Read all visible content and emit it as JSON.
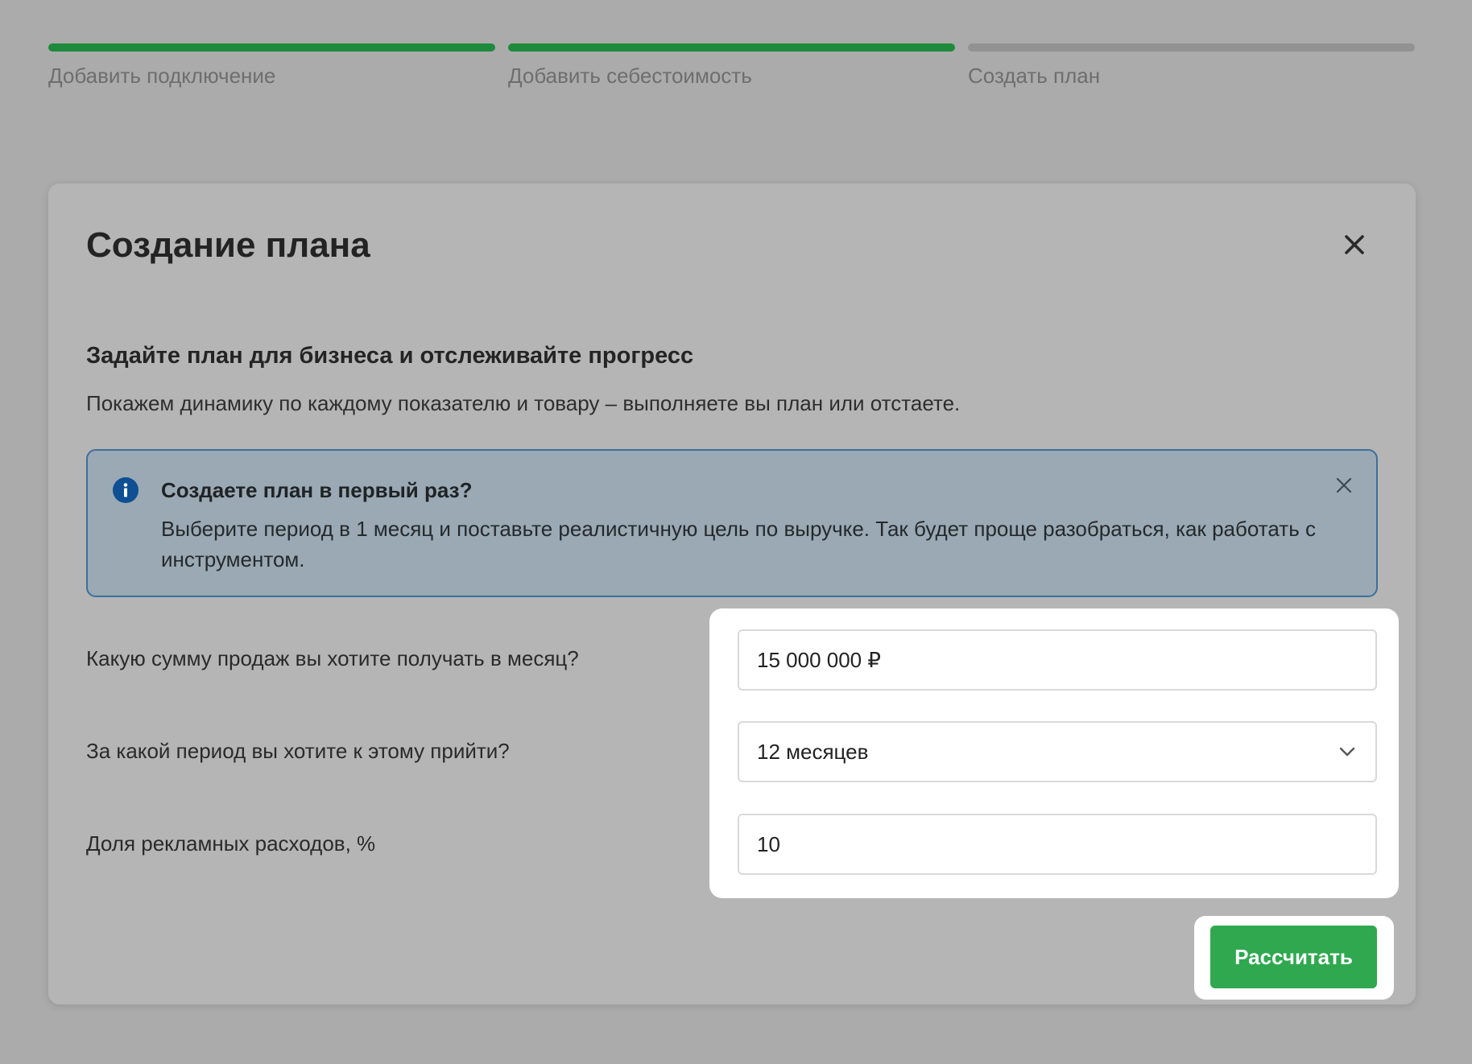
{
  "stepper": {
    "steps": [
      {
        "label": "Добавить подключение",
        "status": "done"
      },
      {
        "label": "Добавить себестоимость",
        "status": "done"
      },
      {
        "label": "Создать план",
        "status": "pending"
      }
    ],
    "colors": {
      "done": "#1e8a3c",
      "pending": "#929292"
    }
  },
  "modal": {
    "title": "Создание плана",
    "close_icon": "close-icon",
    "subtitle": "Задайте план для бизнеса и отслеживайте прогресс",
    "description": "Покажем динамику по каждому показателю и товару – выполняете вы план или отстаете.",
    "info": {
      "icon": "info-icon",
      "title": "Создаете план в первый раз?",
      "text": "Выберите период в 1 месяц и поставьте реалистичную цель по выручке. Так будет проще разобраться, как работать с инструментом.",
      "close_icon": "close-icon"
    },
    "form": {
      "sales": {
        "label": "Какую сумму продаж вы хотите получать в месяц?",
        "value": "15 000 000 ₽"
      },
      "period": {
        "label": "За какой период вы хотите к этому прийти?",
        "value": "12 месяцев",
        "icon": "chevron-down-icon"
      },
      "ads": {
        "label": "Доля рекламных расходов, %",
        "value": "10"
      }
    },
    "submit_label": "Рассчитать"
  },
  "colors": {
    "accent_green": "#2fa84f",
    "info_icon": "#0f4f93",
    "info_border": "#3d6f9e"
  }
}
